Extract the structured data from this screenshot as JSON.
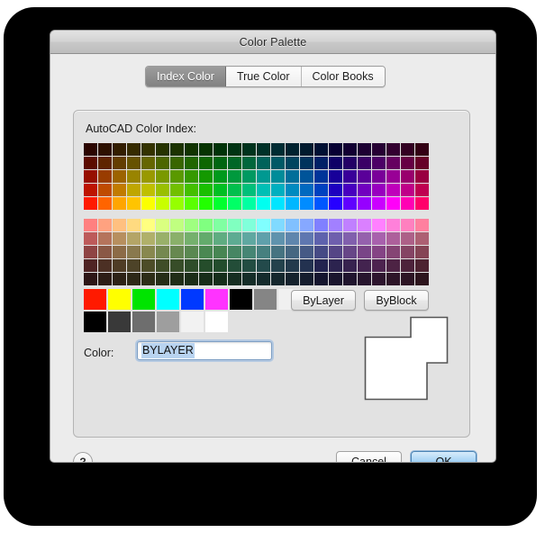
{
  "window": {
    "title": "Color Palette"
  },
  "tabs": [
    {
      "label": "Index Color",
      "active": true
    },
    {
      "label": "True Color",
      "active": false
    },
    {
      "label": "Color Books",
      "active": false
    }
  ],
  "panel": {
    "aci_label": "AutoCAD Color Index:",
    "color_label": "Color:",
    "color_value": "BYLAYER",
    "color_placeholder": "BYLAYER",
    "bylayer_label": "ByLayer",
    "byblock_label": "ByBlock"
  },
  "footer": {
    "help_label": "?",
    "cancel_label": "Cancel",
    "ok_label": "OK"
  },
  "palette": {
    "columns": 24,
    "top_grid": [
      [
        "#2b0500",
        "#2e1100",
        "#331e00",
        "#362b00",
        "#343300",
        "#263300",
        "#1c3300",
        "#113300",
        "#063300",
        "#003308",
        "#003313",
        "#00331d",
        "#003128",
        "#002c33",
        "#00222f",
        "#001a2e",
        "#001033",
        "#070033",
        "#120033",
        "#1d0033",
        "#260033",
        "#330030",
        "#330022",
        "#330014"
      ],
      [
        "#5c0c00",
        "#5e2400",
        "#633d00",
        "#665200",
        "#656600",
        "#4c6600",
        "#396600",
        "#216600",
        "#0d6600",
        "#006611",
        "#006626",
        "#00663c",
        "#00625a",
        "#005966",
        "#00445e",
        "#00335c",
        "#002066",
        "#0e0066",
        "#240066",
        "#3a0066",
        "#4c0066",
        "#660060",
        "#660044",
        "#660028"
      ],
      [
        "#960f00",
        "#993c00",
        "#9c6300",
        "#998400",
        "#999900",
        "#7a9900",
        "#5a9900",
        "#369900",
        "#149900",
        "#00991c",
        "#00993d",
        "#009961",
        "#009991",
        "#008c99",
        "#006e99",
        "#005499",
        "#003499",
        "#170099",
        "#390099",
        "#5a0099",
        "#790099",
        "#990096",
        "#99006d",
        "#990040"
      ],
      [
        "#bd1300",
        "#bf4b00",
        "#c17b00",
        "#bfa600",
        "#bfbf00",
        "#99bf00",
        "#72bf00",
        "#44bf00",
        "#1abf00",
        "#00bf23",
        "#00bf4d",
        "#00bf7a",
        "#00bfb5",
        "#00afbf",
        "#008abf",
        "#0069bf",
        "#0041bf",
        "#1d00bf",
        "#4800bf",
        "#7100bf",
        "#9800bf",
        "#bf00bb",
        "#bf0088",
        "#bf0050"
      ],
      [
        "#ff1a00",
        "#ff6400",
        "#ffa500",
        "#ffc400",
        "#fbff00",
        "#c8ff00",
        "#96ff00",
        "#5aff00",
        "#22ff00",
        "#00ff2f",
        "#00ff66",
        "#00ffa2",
        "#00fff0",
        "#00e5ff",
        "#00b7ff",
        "#008cff",
        "#0057ff",
        "#2700ff",
        "#6000ff",
        "#9600ff",
        "#ca00ff",
        "#ff00f9",
        "#ff00b4",
        "#ff006a"
      ]
    ],
    "bottom_grid": [
      [
        "#ff8080",
        "#ffa280",
        "#ffc080",
        "#ffda80",
        "#ffff80",
        "#daff80",
        "#c0ff80",
        "#9fff80",
        "#80ff80",
        "#80ffa2",
        "#80ffc0",
        "#80ffda",
        "#80ffff",
        "#80daff",
        "#80c0ff",
        "#86a8ff",
        "#8080ff",
        "#a280ff",
        "#c080ff",
        "#da80ff",
        "#ff80ff",
        "#ff80da",
        "#ff80bf",
        "#ff809f"
      ],
      [
        "#bd5a5a",
        "#b5745c",
        "#b78f5f",
        "#b4a567",
        "#b0b06a",
        "#99b06a",
        "#8ab06a",
        "#75b06d",
        "#63ab6c",
        "#5fac81",
        "#5dab92",
        "#5fa8a1",
        "#5fa0ab",
        "#5f93ad",
        "#5f86ad",
        "#5f77b0",
        "#5e62ad",
        "#6e5fad",
        "#8160ad",
        "#9561ad",
        "#a861ad",
        "#ad609b",
        "#ad6088",
        "#ad6073"
      ],
      [
        "#8f4444",
        "#8a5845",
        "#8c6b47",
        "#89794e",
        "#88884f",
        "#758850",
        "#678850",
        "#5a8851",
        "#4a8852",
        "#478653",
        "#468663",
        "#468674",
        "#46807f",
        "#467381",
        "#466781",
        "#465a85",
        "#464a85",
        "#554686",
        "#674687",
        "#794487",
        "#854485",
        "#854474",
        "#854464",
        "#854455"
      ],
      [
        "#4f2424",
        "#4c3024",
        "#4f3c25",
        "#4d4328",
        "#4d4d28",
        "#3f4d28",
        "#374d28",
        "#2f4d2a",
        "#254d2b",
        "#234d2d",
        "#234d38",
        "#234d42",
        "#234a4b",
        "#23424c",
        "#233a4c",
        "#233250",
        "#23234f",
        "#2c234f",
        "#37234f",
        "#43234f",
        "#4d234f",
        "#4d2344",
        "#4d233b",
        "#4d2331"
      ],
      [
        "#2d1616",
        "#2d1d16",
        "#2d2216",
        "#2d2817",
        "#2d2d17",
        "#262d17",
        "#202d17",
        "#1b2d18",
        "#162d19",
        "#152d1b",
        "#152d21",
        "#152d28",
        "#152b2c",
        "#15272d",
        "#15222d",
        "#151d2e",
        "#15152e",
        "#1a152e",
        "#20152e",
        "#27152e",
        "#2d152e",
        "#2d1528",
        "#2d1524",
        "#2d151d"
      ]
    ],
    "standard_row_1": [
      "#ff1a00",
      "#ffff00",
      "#00e400",
      "#00ffff",
      "#0039ff",
      "#ff33ff",
      "#000000",
      "#858585",
      "#f0f0f0"
    ],
    "standard_row_2": [
      "#000000",
      "#393939",
      "#6e6e6e",
      "#9e9e9e",
      "#f2f2f2",
      "#ffffff"
    ]
  }
}
